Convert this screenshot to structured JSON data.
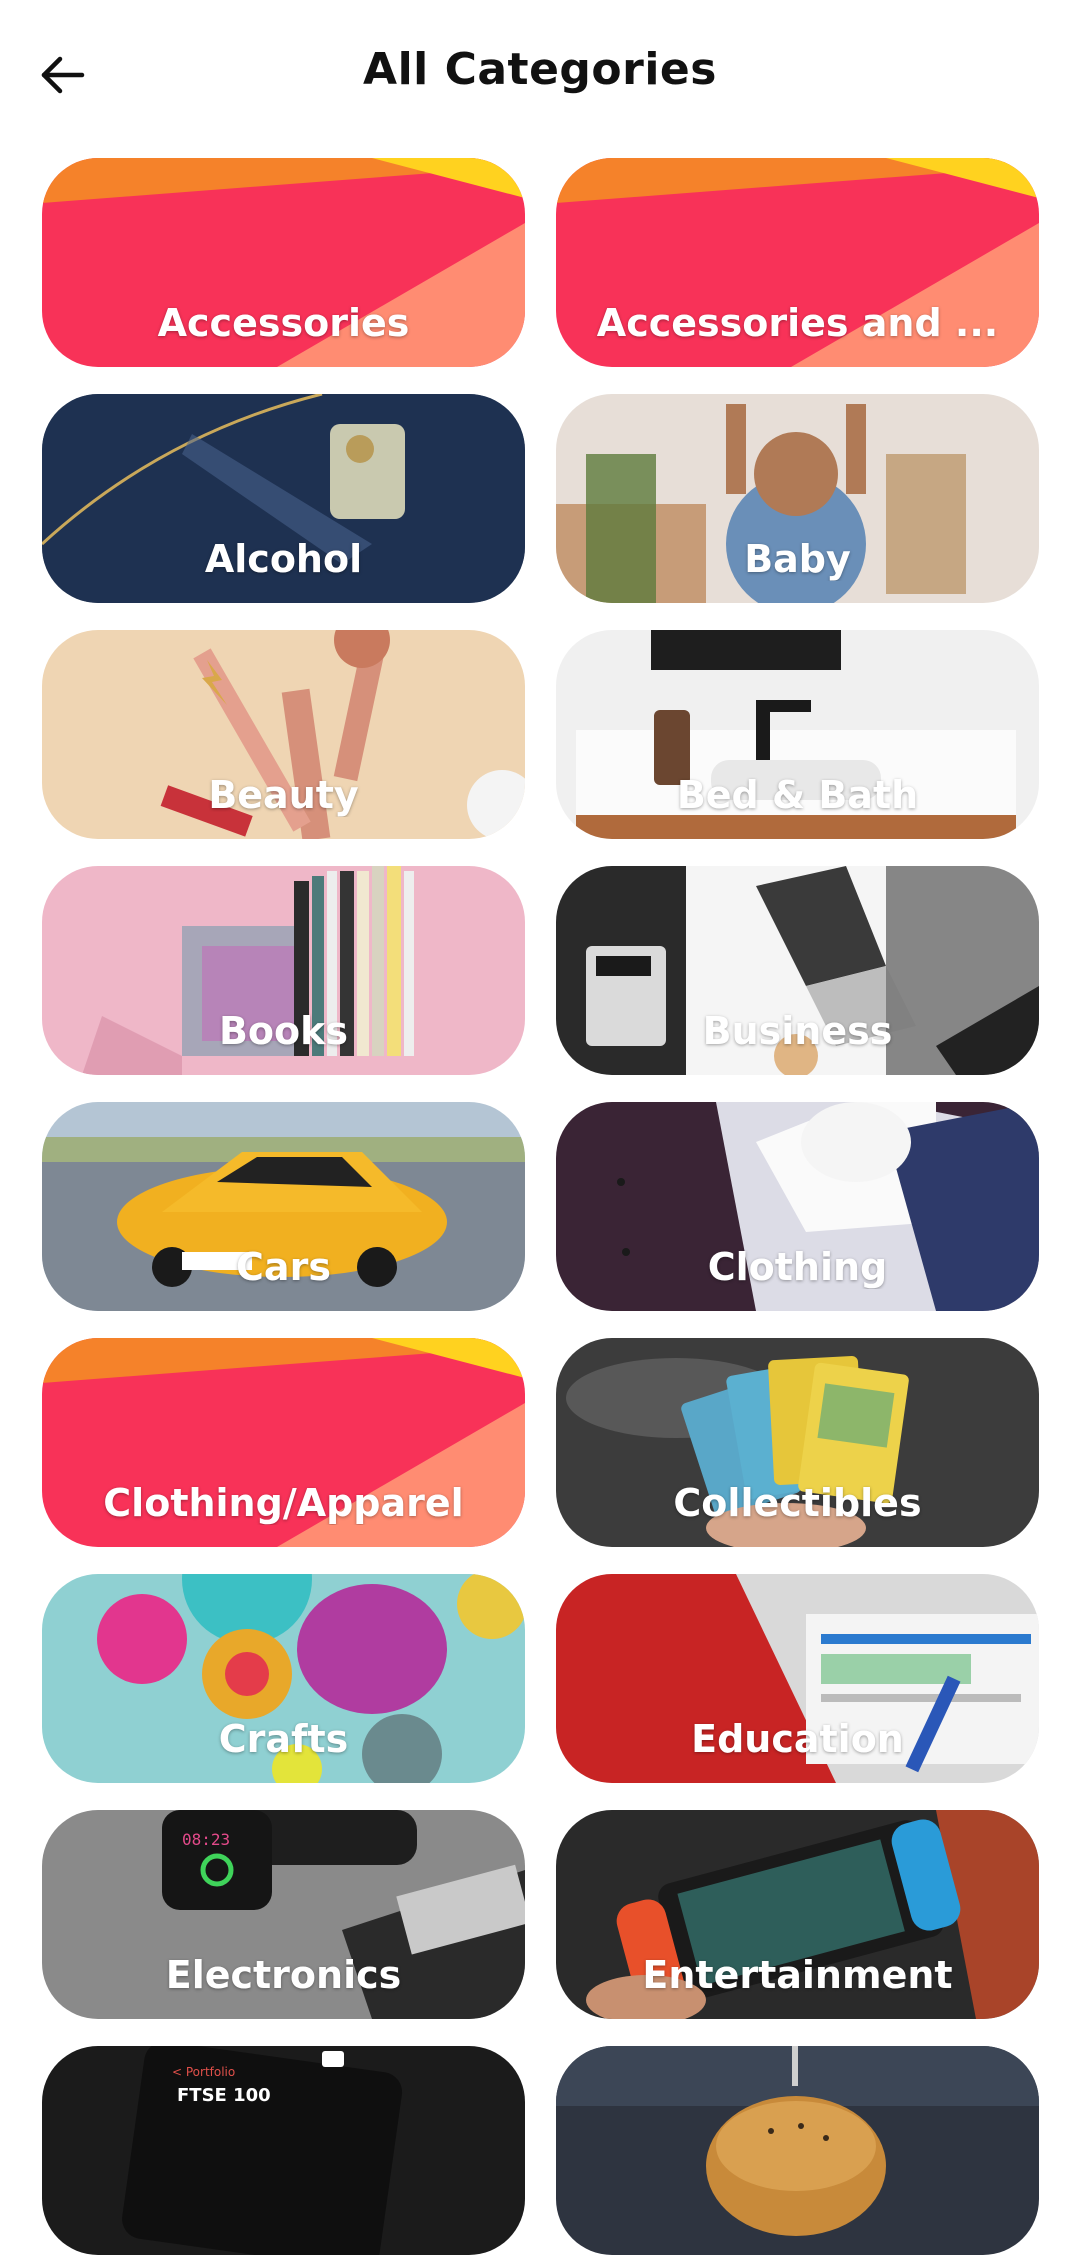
{
  "header": {
    "title": "All Categories",
    "back_icon": "arrow-left-icon"
  },
  "categories": [
    {
      "label": "Accessories",
      "style": "brand"
    },
    {
      "label": "Accessories and ...",
      "style": "brand"
    },
    {
      "label": "Alcohol",
      "style": "photo"
    },
    {
      "label": "Baby",
      "style": "photo"
    },
    {
      "label": "Beauty",
      "style": "photo"
    },
    {
      "label": "Bed & Bath",
      "style": "photo"
    },
    {
      "label": "Books",
      "style": "photo"
    },
    {
      "label": "Business",
      "style": "photo"
    },
    {
      "label": "Cars",
      "style": "photo"
    },
    {
      "label": "Clothing",
      "style": "photo"
    },
    {
      "label": "Clothing/Apparel",
      "style": "brand"
    },
    {
      "label": "Collectibles",
      "style": "photo"
    },
    {
      "label": "Crafts",
      "style": "photo"
    },
    {
      "label": "Education",
      "style": "photo"
    },
    {
      "label": "Electronics",
      "style": "photo"
    },
    {
      "label": "Entertainment",
      "style": "photo"
    },
    {
      "label": "",
      "style": "photo"
    },
    {
      "label": "",
      "style": "photo"
    }
  ],
  "colors": {
    "brand_pink": "#F83258",
    "brand_orange": "#F5822A",
    "brand_yellow": "#FFD21F",
    "brand_salmon": "#FF8C72"
  }
}
